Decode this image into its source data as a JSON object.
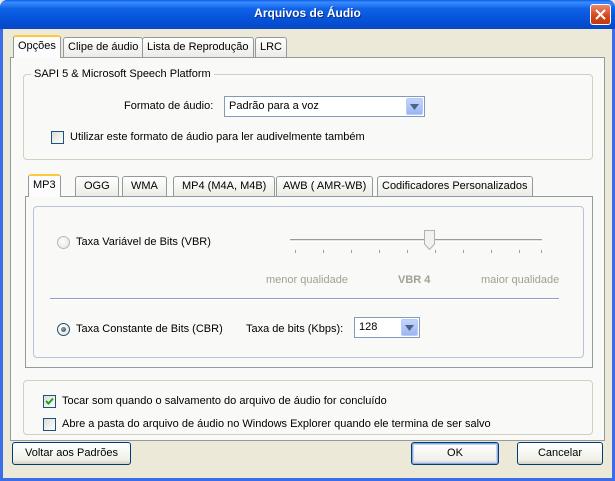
{
  "window": {
    "title": "Arquivos de Áudio"
  },
  "tabs": [
    {
      "label": "Opções",
      "active": true
    },
    {
      "label": "Clipe de áudio",
      "active": false
    },
    {
      "label": "Lista de Reprodução",
      "active": false
    },
    {
      "label": "LRC",
      "active": false
    }
  ],
  "sapi": {
    "group_label": "SAPI 5 & Microsoft Speech Platform",
    "format_label": "Formato de áudio:",
    "format_value": "Padrão para a voz",
    "use_format_checkbox": "Utilizar este formato de áudio para ler audivelmente também",
    "use_format_checked": false
  },
  "codec_tabs": [
    {
      "label": "MP3",
      "active": true
    },
    {
      "label": "OGG",
      "active": false
    },
    {
      "label": "WMA",
      "active": false
    },
    {
      "label": "MP4 (M4A, M4B)",
      "active": false
    },
    {
      "label": "AWB ( AMR-WB)",
      "active": false
    },
    {
      "label": "Codificadores Personalizados",
      "active": false
    }
  ],
  "mp3": {
    "vbr_label": "Taxa Variável de Bits (VBR)",
    "vbr_selected": false,
    "slider_min_label": "menor qualidade",
    "slider_value_label": "VBR 4",
    "slider_max_label": "maior qualidade",
    "slider_level": 4,
    "slider_max": 9,
    "cbr_label": "Taxa Constante de Bits (CBR)",
    "cbr_selected": true,
    "bitrate_label": "Taxa de bits (Kbps):",
    "bitrate_value": "128"
  },
  "options": {
    "play_sound": "Tocar som quando o salvamento do arquivo de áudio for concluído",
    "play_sound_checked": true,
    "open_folder": "Abre a pasta do arquivo de áudio no Windows Explorer quando ele termina de ser salvo",
    "open_folder_checked": false
  },
  "buttons": {
    "defaults": "Voltar aos Padrões",
    "ok": "OK",
    "cancel": "Cancelar"
  }
}
